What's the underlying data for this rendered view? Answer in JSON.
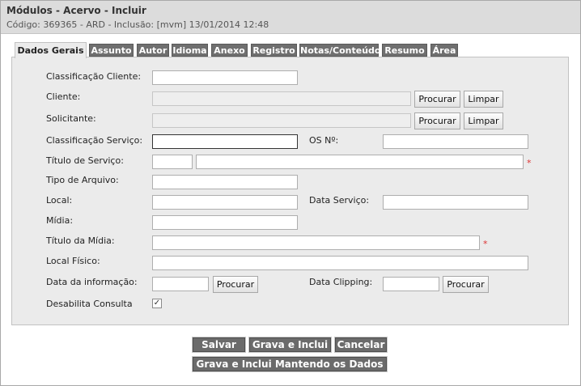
{
  "header": {
    "title": "Módulos - Acervo - Incluir",
    "subtitle": "Código: 369365 - ARD - Inclusão: [mvm] 13/01/2014 12:48"
  },
  "tabs": [
    {
      "label": "Dados Gerais"
    },
    {
      "label": "Assunto"
    },
    {
      "label": "Autor"
    },
    {
      "label": "Idioma"
    },
    {
      "label": "Anexo"
    },
    {
      "label": "Registro"
    },
    {
      "label": "Notas/Conteúdo"
    },
    {
      "label": "Resumo"
    },
    {
      "label": "Área"
    }
  ],
  "form": {
    "classificacao_cliente": {
      "label": "Classificação Cliente:",
      "value": ""
    },
    "cliente": {
      "label": "Cliente:",
      "value": ""
    },
    "solicitante": {
      "label": "Solicitante:",
      "value": ""
    },
    "classificacao_servico": {
      "label": "Classificação Serviço:",
      "value": ""
    },
    "os_numero": {
      "label": "OS Nº:",
      "value": ""
    },
    "titulo_servico": {
      "label": "Título de Serviço:",
      "code": "",
      "value": ""
    },
    "tipo_arquivo": {
      "label": "Tipo de Arquivo:",
      "value": ""
    },
    "local": {
      "label": "Local:",
      "value": ""
    },
    "data_servico": {
      "label": "Data Serviço:",
      "value": ""
    },
    "midia": {
      "label": "Mídia:",
      "value": ""
    },
    "titulo_midia": {
      "label": "Título da Mídia:",
      "value": ""
    },
    "local_fisico": {
      "label": "Local Físico:",
      "value": ""
    },
    "data_informacao": {
      "label": "Data da informação:",
      "value": ""
    },
    "data_clipping": {
      "label": "Data Clipping:",
      "value": ""
    },
    "desabilita_consulta": {
      "label": "Desabilita Consulta",
      "checked": true,
      "mark": "✓"
    },
    "required_mark": "*",
    "procurar_label": "Procurar",
    "limpar_label": "Limpar"
  },
  "actions": {
    "salvar": "Salvar",
    "grava_inclui": "Grava e Inclui",
    "cancelar": "Cancelar",
    "grava_inclui_mantendo": "Grava e Inclui Mantendo os Dados"
  }
}
